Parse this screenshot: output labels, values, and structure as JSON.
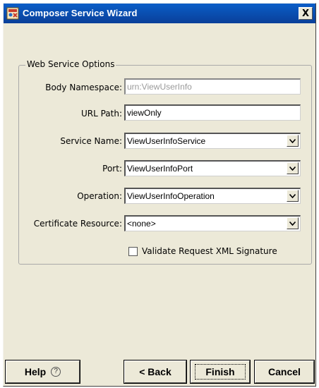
{
  "window": {
    "title": "Composer Service Wizard",
    "close_glyph": "X",
    "app_icon": "composer-app-icon"
  },
  "group": {
    "legend": "Web Service Options"
  },
  "fields": {
    "body_namespace": {
      "label": "Body Namespace:",
      "value": "urn:ViewUserInfo",
      "enabled": false
    },
    "url_path": {
      "label": "URL Path:",
      "value": "viewOnly"
    },
    "service_name": {
      "label": "Service Name:",
      "value": "ViewUserInfoService"
    },
    "port": {
      "label": "Port:",
      "value": "ViewUserInfoPort"
    },
    "operation": {
      "label": "Operation:",
      "value": "ViewUserInfoOperation"
    },
    "certificate_resource": {
      "label": "Certificate Resource:",
      "value": "<none>"
    }
  },
  "validate": {
    "label": "Validate Request XML Signature",
    "checked": false
  },
  "buttons": {
    "help": "Help",
    "help_icon": "question-circle-icon",
    "back": "< Back",
    "finish": "Finish",
    "cancel": "Cancel"
  },
  "colors": {
    "titlebar": "#0a4fb5",
    "dialog_bg": "#ece9d8"
  }
}
